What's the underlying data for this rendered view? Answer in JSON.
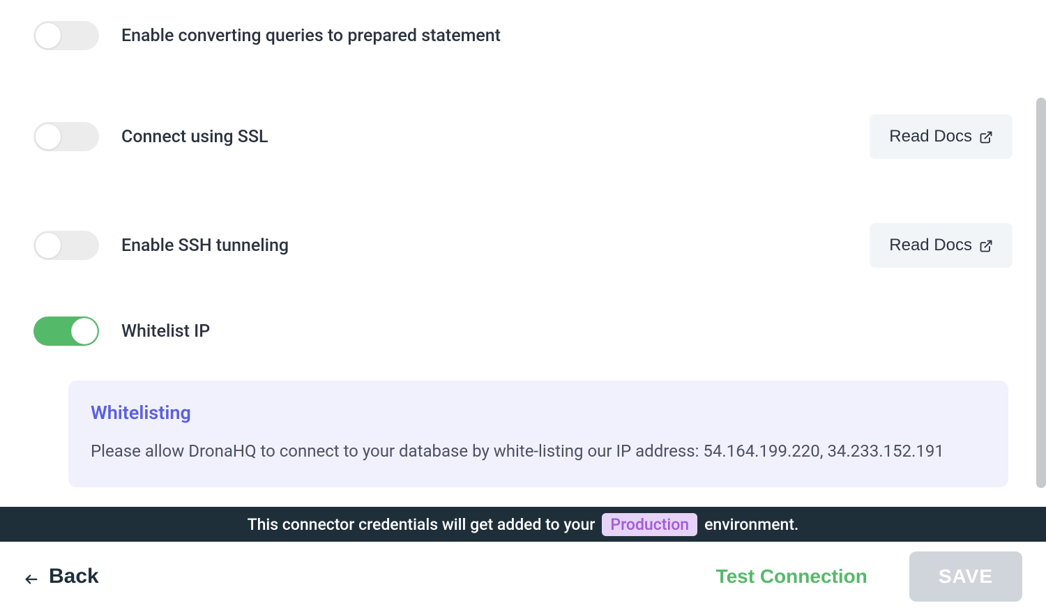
{
  "settings": {
    "prepared": {
      "label": "Enable converting queries to prepared statement"
    },
    "ssl": {
      "label": "Connect using SSL",
      "docs_label": "Read Docs"
    },
    "ssh": {
      "label": "Enable SSH tunneling",
      "docs_label": "Read Docs"
    },
    "whitelist": {
      "label": "Whitelist IP"
    }
  },
  "info_panel": {
    "title": "Whitelisting",
    "body": "Please allow DronaHQ to connect to your database by white-listing our IP address: 54.164.199.220, 34.233.152.191"
  },
  "env_bar": {
    "prefix": "This connector credentials will get added to your",
    "env": "Production",
    "suffix": "environment."
  },
  "footer": {
    "back": "Back",
    "test": "Test Connection",
    "save": "SAVE"
  }
}
